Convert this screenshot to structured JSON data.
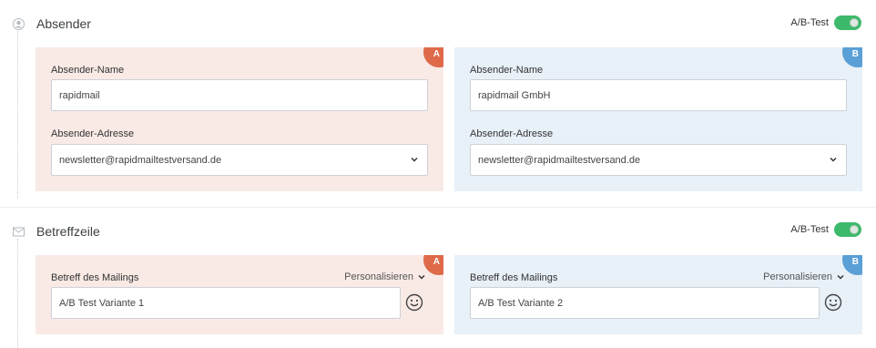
{
  "sections": {
    "sender": {
      "title": "Absender",
      "ab_label": "A/B-Test",
      "icon": "user-circle-icon",
      "variants": {
        "a": {
          "letter": "A",
          "name_label": "Absender-Name",
          "name_value": "rapidmail",
          "address_label": "Absender-Adresse",
          "address_value": "newsletter@rapidmailtestversand.de"
        },
        "b": {
          "letter": "B",
          "name_label": "Absender-Name",
          "name_value": "rapidmail GmbH",
          "address_label": "Absender-Adresse",
          "address_value": "newsletter@rapidmailtestversand.de"
        }
      }
    },
    "subject": {
      "title": "Betreffzeile",
      "ab_label": "A/B-Test",
      "icon": "envelope-icon",
      "variants": {
        "a": {
          "letter": "A",
          "subject_label": "Betreff des Mailings",
          "personalize_label": "Personalisieren",
          "subject_value": "A/B Test Variante 1"
        },
        "b": {
          "letter": "B",
          "subject_label": "Betreff des Mailings",
          "personalize_label": "Personalisieren",
          "subject_value": "A/B Test Variante 2"
        }
      }
    }
  },
  "colors": {
    "variant_a_bg": "#f9eae6",
    "variant_b_bg": "#e8f0f8",
    "variant_a_badge": "#de6a4a",
    "variant_b_badge": "#5a9fd6",
    "toggle_on": "#3db96b"
  }
}
